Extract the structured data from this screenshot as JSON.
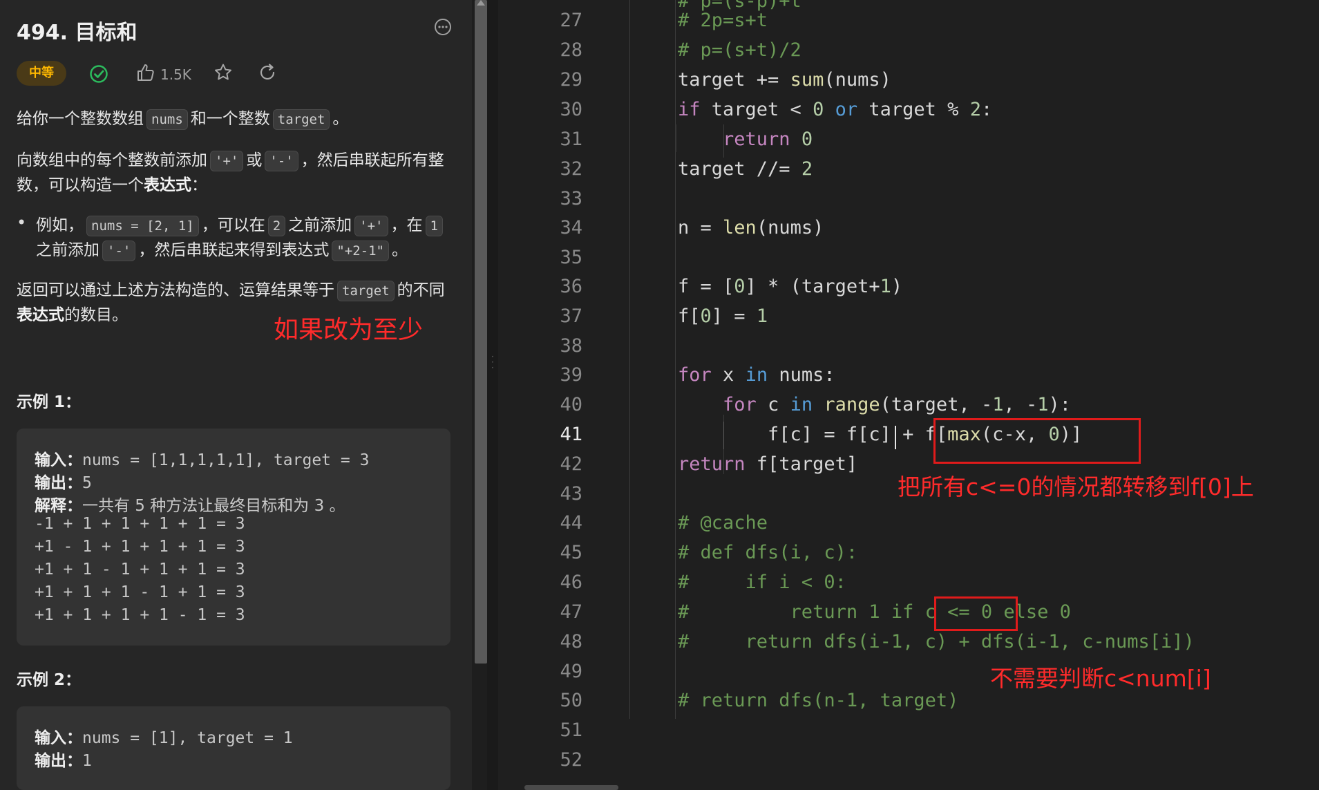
{
  "problem": {
    "title": "494. 目标和",
    "difficulty": "中等",
    "likes": "1.5K",
    "desc1": {
      "t1": "给你一个整数数组",
      "c1": "nums",
      "t2": "和一个整数",
      "c2": "target",
      "t3": "。"
    },
    "desc2": {
      "t1": "向数组中的每个整数前添加",
      "c1": "'+'",
      "t2": "或",
      "c2": "'-'",
      "t3": "，然后串联起所有整数，可以构造一个",
      "b1": "表达式",
      "t4": "："
    },
    "bullet": {
      "t1": "例如，",
      "c1": "nums = [2, 1]",
      "t2": "，可以在",
      "c2": "2",
      "t3": "之前添加",
      "c3": "'+'",
      "t4": "，在",
      "c4": "1",
      "t5": "之前添加",
      "c5": "'-'",
      "t6": "，然后串联起来得到表达式",
      "c6": "\"+2-1\"",
      "t7": "。"
    },
    "desc3": {
      "t1": "返回可以通过上述方法构造的、运算结果等于",
      "c1": "target",
      "t2": "的不同",
      "b1": "表达式",
      "t3": "的数目。"
    },
    "annotation": "如果改为至少",
    "example1": {
      "title": "示例 1：",
      "input_label": "输入：",
      "input": "nums = [1,1,1,1,1], target = 3",
      "output_label": "输出：",
      "output": "5",
      "explain_label": "解释：",
      "explain": "一共有 5 种方法让最终目标和为 3 。",
      "lines": [
        "-1 + 1 + 1 + 1 + 1 = 3",
        "+1 - 1 + 1 + 1 + 1 = 3",
        "+1 + 1 - 1 + 1 + 1 = 3",
        "+1 + 1 + 1 - 1 + 1 = 3",
        "+1 + 1 + 1 + 1 - 1 = 3"
      ]
    },
    "example2": {
      "title": "示例 2：",
      "input_label": "输入：",
      "input": "nums = [1], target = 1",
      "output_label": "输出：",
      "output": "1"
    }
  },
  "editor": {
    "line_numbers": [
      "27",
      "28",
      "29",
      "30",
      "31",
      "32",
      "33",
      "34",
      "35",
      "36",
      "37",
      "38",
      "39",
      "40",
      "41",
      "42",
      "43",
      "44",
      "45",
      "46",
      "47",
      "48",
      "49",
      "50",
      "51",
      "52"
    ],
    "active_line": "41",
    "annotations": {
      "a1": "把所有c<=0的情况都转移到f[0]上",
      "a2": "不需要判断c<num[i]"
    }
  },
  "colors": {
    "accent_red": "#e01b1b",
    "difficulty": "#ffb800",
    "solved": "#2cbb5d"
  }
}
